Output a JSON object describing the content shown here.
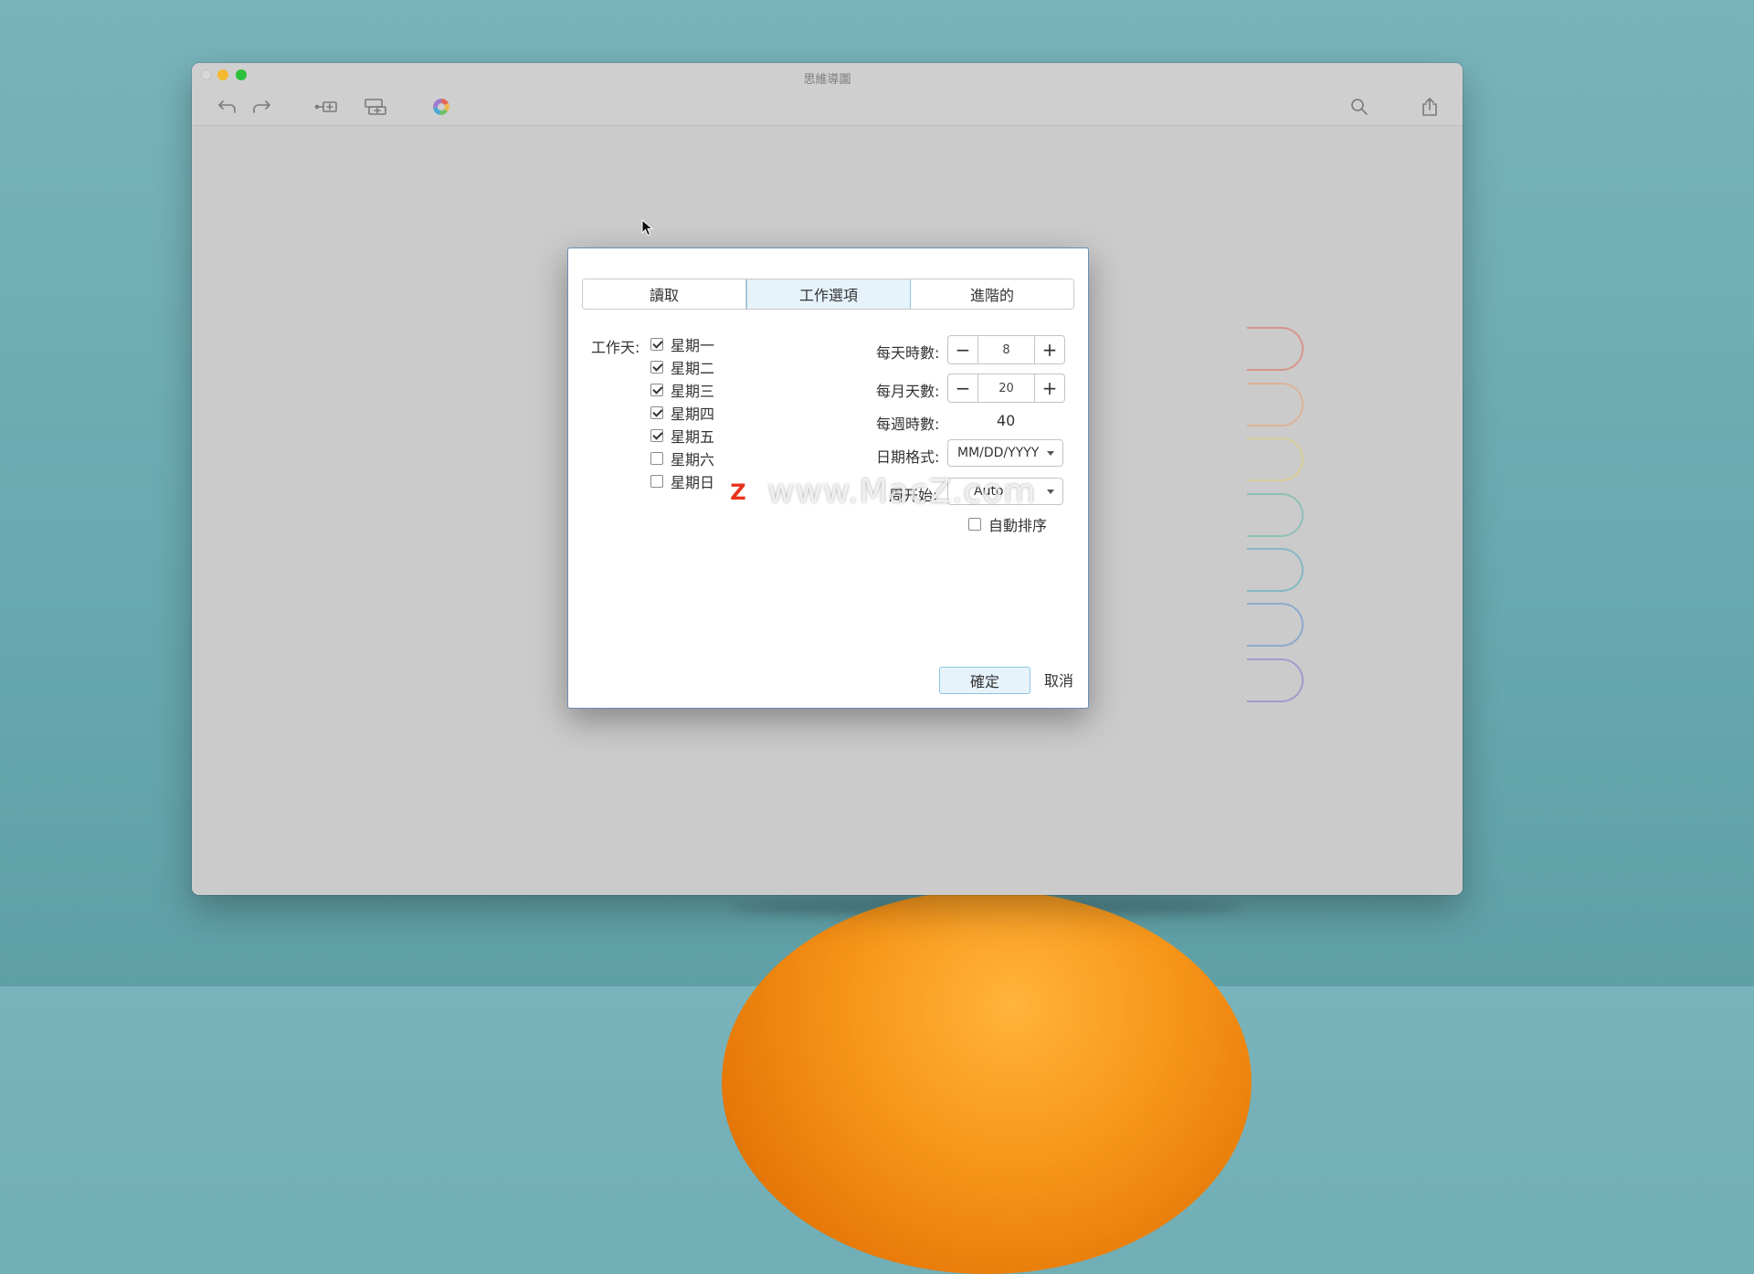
{
  "window": {
    "title": "思維導圖"
  },
  "toolbar": {
    "icons": [
      "undo-icon",
      "redo-icon",
      "insert-child-icon",
      "insert-sibling-icon",
      "color-theme-icon",
      "search-icon",
      "share-icon"
    ]
  },
  "zoom": {
    "minus": "−",
    "fit": "fit-icon",
    "plus": "+"
  },
  "dialog": {
    "tabs": [
      {
        "label": "讀取",
        "active": false
      },
      {
        "label": "工作選項",
        "active": true
      },
      {
        "label": "進階的",
        "active": false
      }
    ],
    "workdays_label": "工作天:",
    "days": [
      {
        "label": "星期一",
        "checked": true
      },
      {
        "label": "星期二",
        "checked": true
      },
      {
        "label": "星期三",
        "checked": true
      },
      {
        "label": "星期四",
        "checked": true
      },
      {
        "label": "星期五",
        "checked": true
      },
      {
        "label": "星期六",
        "checked": false
      },
      {
        "label": "星期日",
        "checked": false
      }
    ],
    "hours_per_day": {
      "label": "每天時數:",
      "value": "8"
    },
    "days_per_month": {
      "label": "每月天數:",
      "value": "20"
    },
    "hours_per_week": {
      "label": "每週時數:",
      "value": "40"
    },
    "date_format": {
      "label": "日期格式:",
      "value": "MM/DD/YYYY"
    },
    "week_start": {
      "label": "周开始:",
      "value": "Auto"
    },
    "auto_sort": {
      "label": "自動排序",
      "checked": false
    },
    "ok_label": "確定",
    "cancel_label": "取消"
  },
  "watermark": {
    "logo": "Z",
    "text": "www.MacZ.com"
  },
  "colors": {
    "accent": "#8fc4e4",
    "accent_bg": "#e7f3fb",
    "traffic_min": "#f5b930",
    "traffic_max": "#2cc13d",
    "node_outlines": [
      "#e06a5a",
      "#e8a070",
      "#e0d070",
      "#5fb8a8",
      "#4fa8c0",
      "#5a90d0",
      "#7a78d0"
    ]
  }
}
